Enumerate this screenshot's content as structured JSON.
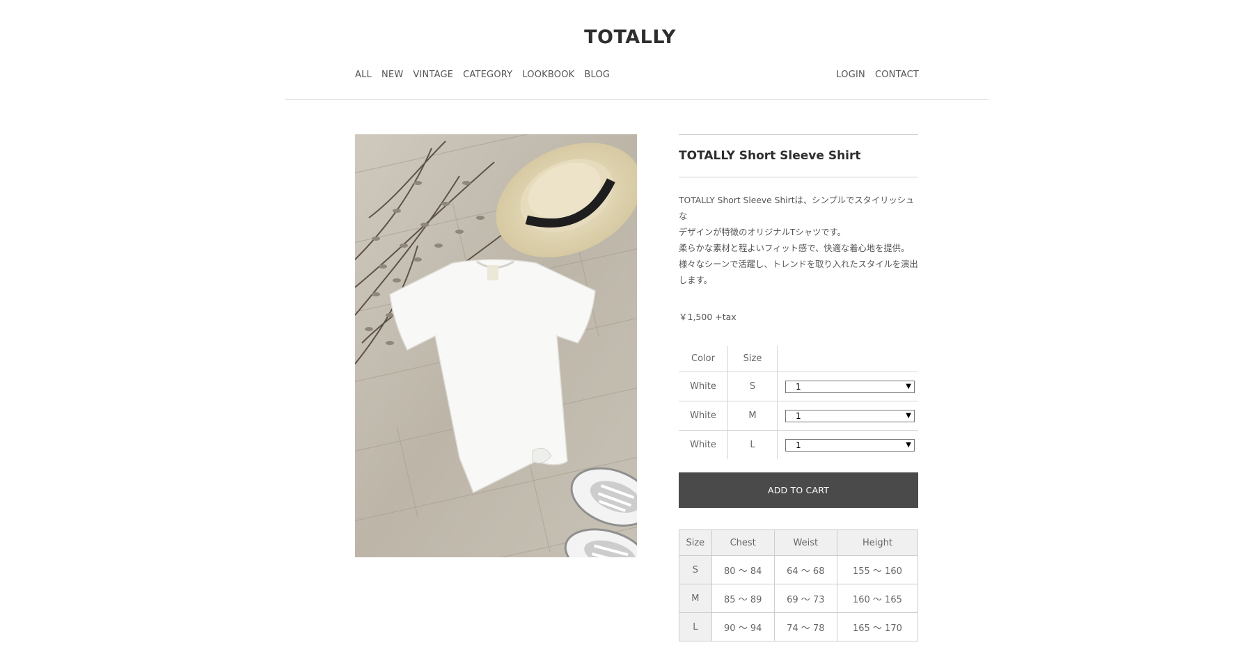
{
  "site": {
    "logo": "TOTALLY"
  },
  "nav": {
    "left": [
      "ALL",
      "NEW",
      "VINTAGE",
      "CATEGORY",
      "LOOKBOOK",
      "BLOG"
    ],
    "right": [
      "LOGIN",
      "CONTACT"
    ]
  },
  "product": {
    "title": "TOTALLY Short Sleeve Shirt",
    "description": [
      "TOTALLY Short Sleeve Shirtは、シンプルでスタイリッシュな",
      "デザインが特徴のオリジナルTシャツです。",
      "柔らかな素材と程よいフィット感で、快適な着心地を提供。",
      "様々なシーンで活躍し、トレンドを取り入れたスタイルを演出",
      "します。"
    ],
    "price": "￥1,500 +tax",
    "image_icon": "tshirt-product-photo"
  },
  "variants": {
    "headers": {
      "color": "Color",
      "size": "Size"
    },
    "rows": [
      {
        "color": "White",
        "size": "S",
        "qty": "1"
      },
      {
        "color": "White",
        "size": "M",
        "qty": "1"
      },
      {
        "color": "White",
        "size": "L",
        "qty": "1"
      }
    ]
  },
  "cart": {
    "label": "ADD TO CART"
  },
  "size_chart": {
    "headers": [
      "Size",
      "Chest",
      "Weist",
      "Height"
    ],
    "rows": [
      [
        "S",
        "80 〜 84",
        "64 〜 68",
        "155 〜 160"
      ],
      [
        "M",
        "85 〜 89",
        "69 〜 73",
        "160 〜 165"
      ],
      [
        "L",
        "90 〜 94",
        "74 〜 78",
        "165 〜 170"
      ]
    ]
  },
  "colors": {
    "button_bg": "#4a4a4a",
    "rule": "#cfcfcf",
    "floor": "#bdb6a9"
  }
}
